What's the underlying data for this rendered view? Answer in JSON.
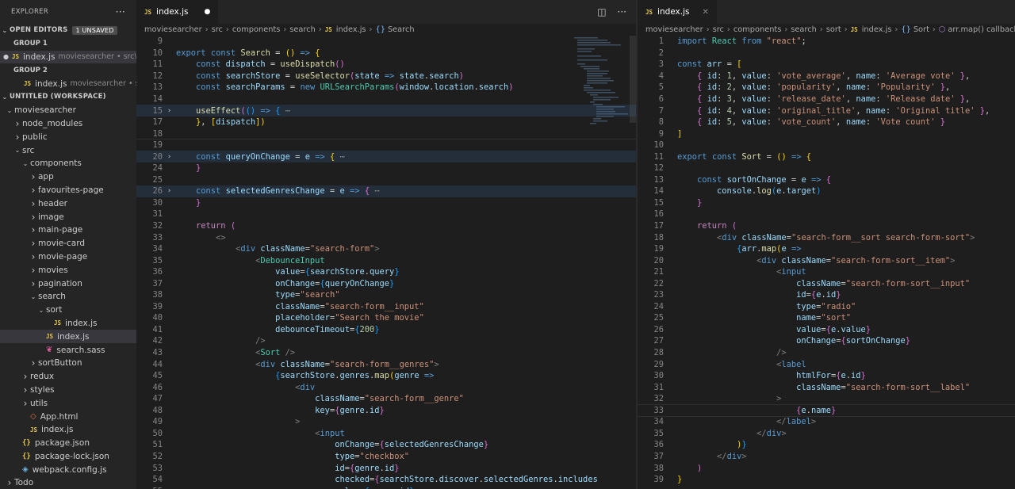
{
  "sidebar": {
    "title": "EXPLORER",
    "open_editors": {
      "label": "OPEN EDITORS",
      "badge": "1 UNSAVED"
    },
    "group1": {
      "label": "GROUP 1",
      "file": "index.js",
      "desc": "moviesearcher • src\\..."
    },
    "group2": {
      "label": "GROUP 2",
      "file": "index.js",
      "desc": "moviesearcher • src\\..."
    },
    "workspace": "UNTITLED (WORKSPACE)",
    "tree": [
      {
        "label": "moviesearcher",
        "depth": 0,
        "type": "folder-open"
      },
      {
        "label": "node_modules",
        "depth": 1,
        "type": "folder"
      },
      {
        "label": "public",
        "depth": 1,
        "type": "folder"
      },
      {
        "label": "src",
        "depth": 1,
        "type": "folder-open"
      },
      {
        "label": "components",
        "depth": 2,
        "type": "folder-open"
      },
      {
        "label": "app",
        "depth": 3,
        "type": "folder"
      },
      {
        "label": "favourites-page",
        "depth": 3,
        "type": "folder"
      },
      {
        "label": "header",
        "depth": 3,
        "type": "folder"
      },
      {
        "label": "image",
        "depth": 3,
        "type": "folder"
      },
      {
        "label": "main-page",
        "depth": 3,
        "type": "folder"
      },
      {
        "label": "movie-card",
        "depth": 3,
        "type": "folder"
      },
      {
        "label": "movie-page",
        "depth": 3,
        "type": "folder"
      },
      {
        "label": "movies",
        "depth": 3,
        "type": "folder"
      },
      {
        "label": "pagination",
        "depth": 3,
        "type": "folder"
      },
      {
        "label": "search",
        "depth": 3,
        "type": "folder-open"
      },
      {
        "label": "sort",
        "depth": 4,
        "type": "folder-open"
      },
      {
        "label": "index.js",
        "depth": 5,
        "type": "js"
      },
      {
        "label": "index.js",
        "depth": 4,
        "type": "js",
        "active": true
      },
      {
        "label": "search.sass",
        "depth": 4,
        "type": "sass"
      },
      {
        "label": "sortButton",
        "depth": 3,
        "type": "folder"
      },
      {
        "label": "redux",
        "depth": 2,
        "type": "folder"
      },
      {
        "label": "styles",
        "depth": 2,
        "type": "folder"
      },
      {
        "label": "utils",
        "depth": 2,
        "type": "folder"
      },
      {
        "label": "App.html",
        "depth": 2,
        "type": "html"
      },
      {
        "label": "index.js",
        "depth": 2,
        "type": "js"
      },
      {
        "label": "package.json",
        "depth": 1,
        "type": "json"
      },
      {
        "label": "package-lock.json",
        "depth": 1,
        "type": "json"
      },
      {
        "label": "webpack.config.js",
        "depth": 1,
        "type": "webpack"
      },
      {
        "label": "Todo",
        "depth": 0,
        "type": "folder"
      }
    ]
  },
  "left_editor": {
    "tab_label": "index.js",
    "breadcrumb": [
      "moviesearcher",
      "src",
      "components",
      "search",
      "index.js",
      "Search"
    ]
  },
  "right_editor": {
    "tab_label": "index.js",
    "breadcrumb": [
      "moviesearcher",
      "src",
      "components",
      "search",
      "sort",
      "index.js",
      "Sort",
      "arr.map() callback"
    ]
  },
  "icons": {
    "file": "js-file-icon",
    "split": "split-editor-icon",
    "more": "more-actions-icon",
    "close": "close-icon"
  }
}
